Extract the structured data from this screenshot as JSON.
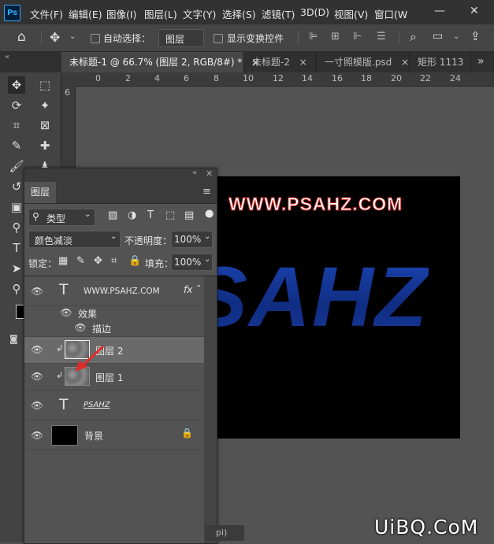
{
  "app": {
    "logo": "Ps"
  },
  "menu": [
    "文件(F)",
    "编辑(E)",
    "图像(I)",
    "图层(L)",
    "文字(Y)",
    "选择(S)",
    "滤镜(T)",
    "3D(D)",
    "视图(V)",
    "窗口(W"
  ],
  "window_controls": {
    "minimize": "—",
    "close": "✕"
  },
  "options": {
    "auto_select_label": "自动选择：",
    "auto_select_value": "图层",
    "show_transform_label": "显示变换控件"
  },
  "tabs": [
    {
      "label": "未标题-1 @ 66.7% (图层 2, RGB/8#) *",
      "close": "×"
    },
    {
      "label": "未标题-2",
      "close": "×"
    },
    {
      "label": "一寸照模版.psd",
      "close": "×"
    },
    {
      "label": "矩形 1113",
      "close": ""
    }
  ],
  "tabs_overflow": "»",
  "ruler_h": [
    "0",
    "2",
    "4",
    "6",
    "8",
    "10",
    "12",
    "14",
    "16",
    "18",
    "20",
    "22",
    "24"
  ],
  "ruler_v": [
    "6"
  ],
  "canvas": {
    "watermark_text": "WWW.PSAHZ.COM",
    "big_text": "SAHZ",
    "bg_color": "#000000",
    "blue_color": "#1a3fa8",
    "stroke_color": "#c0231e"
  },
  "layers_panel": {
    "title": "图层",
    "filter_label": "类型",
    "blend_mode": "颜色减淡",
    "opacity_label": "不透明度：",
    "opacity_value": "100%",
    "lock_label": "锁定：",
    "fill_label": "填充：",
    "fill_value": "100%",
    "layers": [
      {
        "name": "WWW.PSAHZ.COM",
        "type": "text",
        "fx": "fx"
      },
      {
        "name": "效果",
        "type": "effects"
      },
      {
        "name": "描边",
        "type": "effect-item"
      },
      {
        "name": "图层 2",
        "type": "pixel",
        "clipped": true,
        "selected": true
      },
      {
        "name": "图层 1",
        "type": "pixel",
        "clipped": true
      },
      {
        "name": "PSAHZ",
        "type": "text"
      },
      {
        "name": "背景",
        "type": "background",
        "locked": true
      }
    ]
  },
  "status_fragment": "pi)",
  "site_watermark": "UiBQ.CoM"
}
